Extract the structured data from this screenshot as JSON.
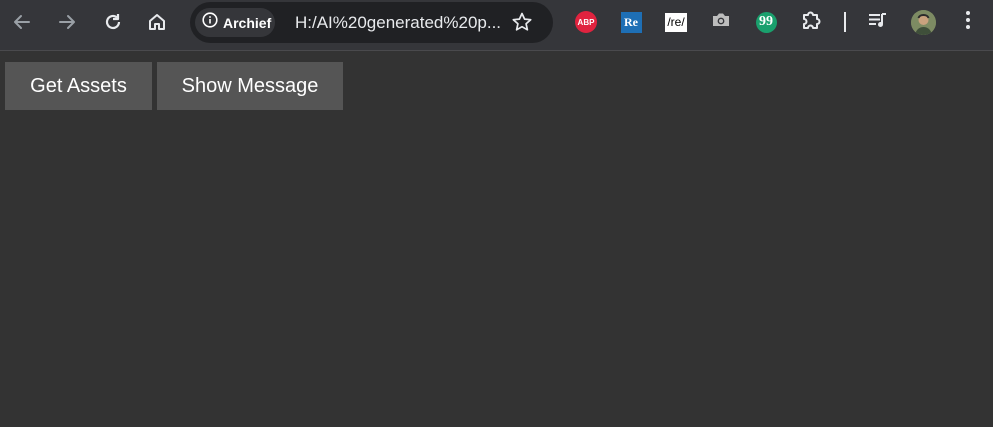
{
  "browser": {
    "security_chip_label": "Archief",
    "url": "H:/AI%20generated%20p...",
    "icons": {
      "back": "arrow-left-icon",
      "forward": "arrow-right-icon",
      "reload": "reload-icon",
      "home": "home-icon",
      "info": "info-icon",
      "bookmark": "star-icon",
      "extensions": "puzzle-icon",
      "media": "media-control-icon",
      "menu": "kebab-menu-icon"
    },
    "extensions": {
      "abp_label": "ABP",
      "re_label": "Re",
      "slash_re_label": "/re/",
      "quote_label": "99"
    }
  },
  "page": {
    "buttons": {
      "get_assets": "Get Assets",
      "show_message": "Show Message"
    }
  },
  "colors": {
    "page_background": "#333333",
    "toolbar_background": "#35363a",
    "button_background": "#555555"
  }
}
